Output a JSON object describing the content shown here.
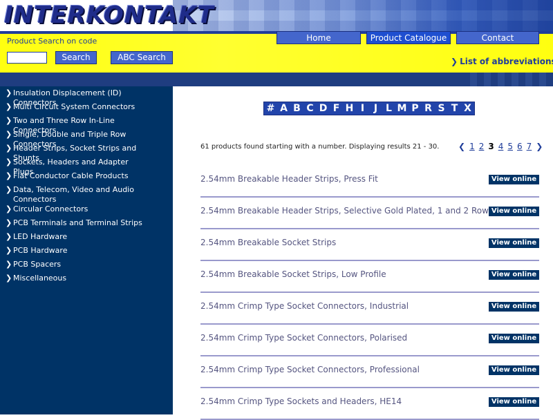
{
  "logo": {
    "text": "INTERKONTAKT"
  },
  "search": {
    "label": "Product Search on code",
    "input_value": "",
    "search_label": "Search",
    "abc_label": "ABC Search"
  },
  "nav": {
    "home": "Home",
    "catalogue": "Product Catalogue",
    "contact": "Contact"
  },
  "abbreviations_link": "List of abbreviations",
  "sidebar": {
    "items": [
      "Insulation Displacement (ID) Connectors",
      "Multi Circuit System Connectors",
      "Two and Three Row In-Line Connectors",
      "Single, Double and Triple Row Connectors",
      "Header Strips, Socket Strips and Shunts",
      "Sockets, Headers and Adapter Plugs",
      "Flat Conductor Cable Products",
      "Data, Telecom, Video and Audio Connectors",
      "Circular Connectors",
      "PCB Terminals and Terminal Strips",
      "LED Hardware",
      "PCB Hardware",
      "PCB Spacers",
      "Miscellaneous"
    ]
  },
  "alphabet": [
    "#",
    "A",
    "B",
    "C",
    "D",
    "F",
    "H",
    "I",
    "J",
    "L",
    "M",
    "P",
    "R",
    "S",
    "T",
    "X"
  ],
  "results": {
    "summary": "61 products found starting with a number. Displaying results 21 - 30.",
    "pages": [
      "1",
      "2",
      "3",
      "4",
      "5",
      "6",
      "7"
    ],
    "current_page": "3"
  },
  "products": [
    {
      "name": "2.54mm Breakable Header Strips, Press Fit",
      "button": "View online"
    },
    {
      "name": "2.54mm Breakable Header Strips, Selective Gold Plated, 1 and 2 Rows",
      "button": "View online"
    },
    {
      "name": "2.54mm Breakable Socket Strips",
      "button": "View online"
    },
    {
      "name": "2.54mm Breakable Socket Strips, Low Profile",
      "button": "View online"
    },
    {
      "name": "2.54mm Crimp Type Socket Connectors, Industrial",
      "button": "View online"
    },
    {
      "name": "2.54mm Crimp Type Socket Connectors, Polarised",
      "button": "View online"
    },
    {
      "name": "2.54mm Crimp Type Socket Connectors, Professional",
      "button": "View online"
    },
    {
      "name": "2.54mm Crimp Type Sockets and Headers, HE14",
      "button": "View online"
    }
  ]
}
